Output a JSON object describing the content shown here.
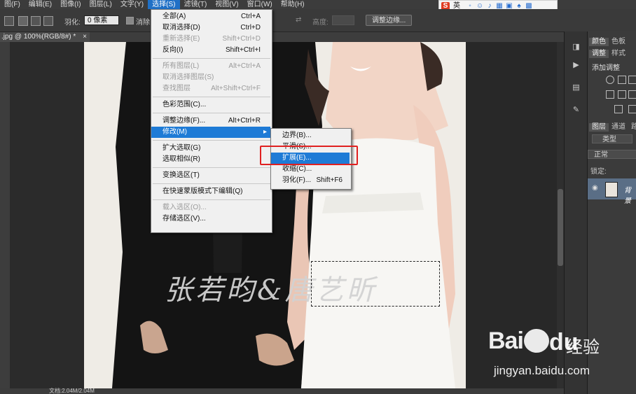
{
  "menubar": {
    "items": [
      "图(F)",
      "编辑(E)",
      "图像(I)",
      "图层(L)",
      "文字(Y)",
      "选择(S)",
      "滤镜(T)",
      "视图(V)",
      "窗口(W)",
      "帮助(H)"
    ],
    "active_index": 5
  },
  "options": {
    "feather_label": "羽化:",
    "feather_value": "0 像素",
    "antialias_label": "消除",
    "height_label": "高度:",
    "refine_button": "调整边缘..."
  },
  "document": {
    "tab_title": ".jpg @ 100%(RGB/8#) *",
    "status_text": "文档:2.04M/2.04M"
  },
  "select_menu": {
    "items": [
      {
        "label": "全部(A)",
        "shortcut": "Ctrl+A",
        "disabled": false
      },
      {
        "label": "取消选择(D)",
        "shortcut": "Ctrl+D",
        "disabled": false
      },
      {
        "label": "重新选择(E)",
        "shortcut": "Shift+Ctrl+D",
        "disabled": true
      },
      {
        "label": "反向(I)",
        "shortcut": "Shift+Ctrl+I",
        "disabled": false
      },
      {
        "label": "所有图层(L)",
        "shortcut": "Alt+Ctrl+A",
        "disabled": true
      },
      {
        "label": "取消选择图层(S)",
        "shortcut": "",
        "disabled": true
      },
      {
        "label": "查找图层",
        "shortcut": "Alt+Shift+Ctrl+F",
        "disabled": true
      },
      {
        "label": "色彩范围(C)...",
        "shortcut": "",
        "disabled": false
      },
      {
        "label": "调整边缘(F)...",
        "shortcut": "Alt+Ctrl+R",
        "disabled": false
      },
      {
        "label": "修改(M)",
        "shortcut": "",
        "disabled": false
      },
      {
        "label": "扩大选取(G)",
        "shortcut": "",
        "disabled": false
      },
      {
        "label": "选取相似(R)",
        "shortcut": "",
        "disabled": false
      },
      {
        "label": "变换选区(T)",
        "shortcut": "",
        "disabled": false
      },
      {
        "label": "在快速蒙版模式下编辑(Q)",
        "shortcut": "",
        "disabled": false
      },
      {
        "label": "载入选区(O)...",
        "shortcut": "",
        "disabled": true
      },
      {
        "label": "存储选区(V)...",
        "shortcut": "",
        "disabled": false
      }
    ]
  },
  "modify_submenu": {
    "items": [
      {
        "label": "边界(B)...",
        "shortcut": ""
      },
      {
        "label": "平滑(S)...",
        "shortcut": ""
      },
      {
        "label": "扩展(E)...",
        "shortcut": ""
      },
      {
        "label": "收缩(C)...",
        "shortcut": ""
      },
      {
        "label": "羽化(F)...",
        "shortcut": "Shift+F6"
      }
    ],
    "highlight_index": 2
  },
  "panels": {
    "tab_color": "颜色",
    "tab_swatches": "色板",
    "tab_adjust": "调整",
    "tab_styles": "样式",
    "adjust_title": "添加调整",
    "tab_layers": "图层",
    "tab_channels": "通道",
    "tab_paths": "路",
    "kind_label": "类型",
    "blend_mode": "正常",
    "lock_label": "锁定:",
    "layer_name": "背景"
  },
  "sogou": {
    "lang_label": "英"
  },
  "image_text": {
    "signature": "张若昀&唐艺昕"
  },
  "watermark": {
    "logo": "Bai",
    "logo_cn": "经验",
    "url": "jingyan.baidu.com"
  },
  "colors": {
    "menu_highlight": "#1e7bd6",
    "annotation_box": "#e02020",
    "menubar_active": "#1f70c6"
  }
}
